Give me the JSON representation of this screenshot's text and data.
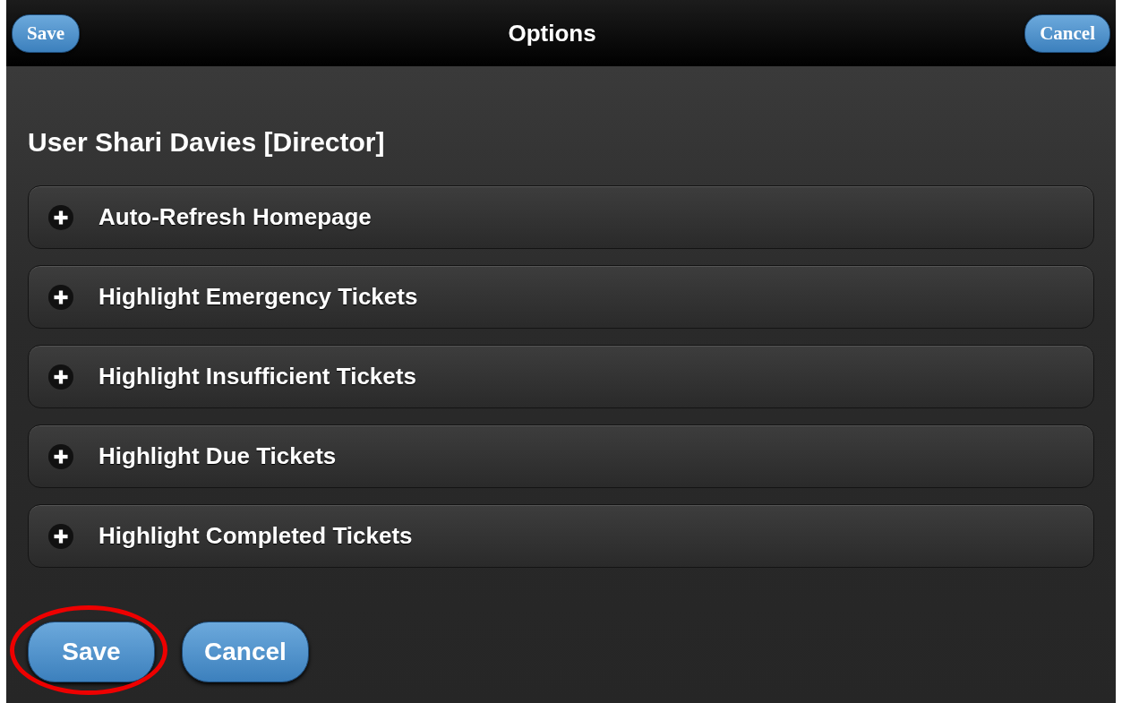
{
  "header": {
    "title": "Options",
    "left_button": "Save",
    "right_button": "Cancel"
  },
  "user_heading": "User Shari Davies [Director]",
  "sections": [
    {
      "label": "Auto-Refresh Homepage",
      "expanded": false
    },
    {
      "label": "Highlight Emergency Tickets",
      "expanded": false
    },
    {
      "label": "Highlight Insufficient Tickets",
      "expanded": false
    },
    {
      "label": "Highlight Due Tickets",
      "expanded": false
    },
    {
      "label": "Highlight Completed Tickets",
      "expanded": false
    }
  ],
  "footer_buttons": [
    {
      "label": "Save",
      "circled": true
    },
    {
      "label": "Cancel",
      "circled": false
    }
  ]
}
